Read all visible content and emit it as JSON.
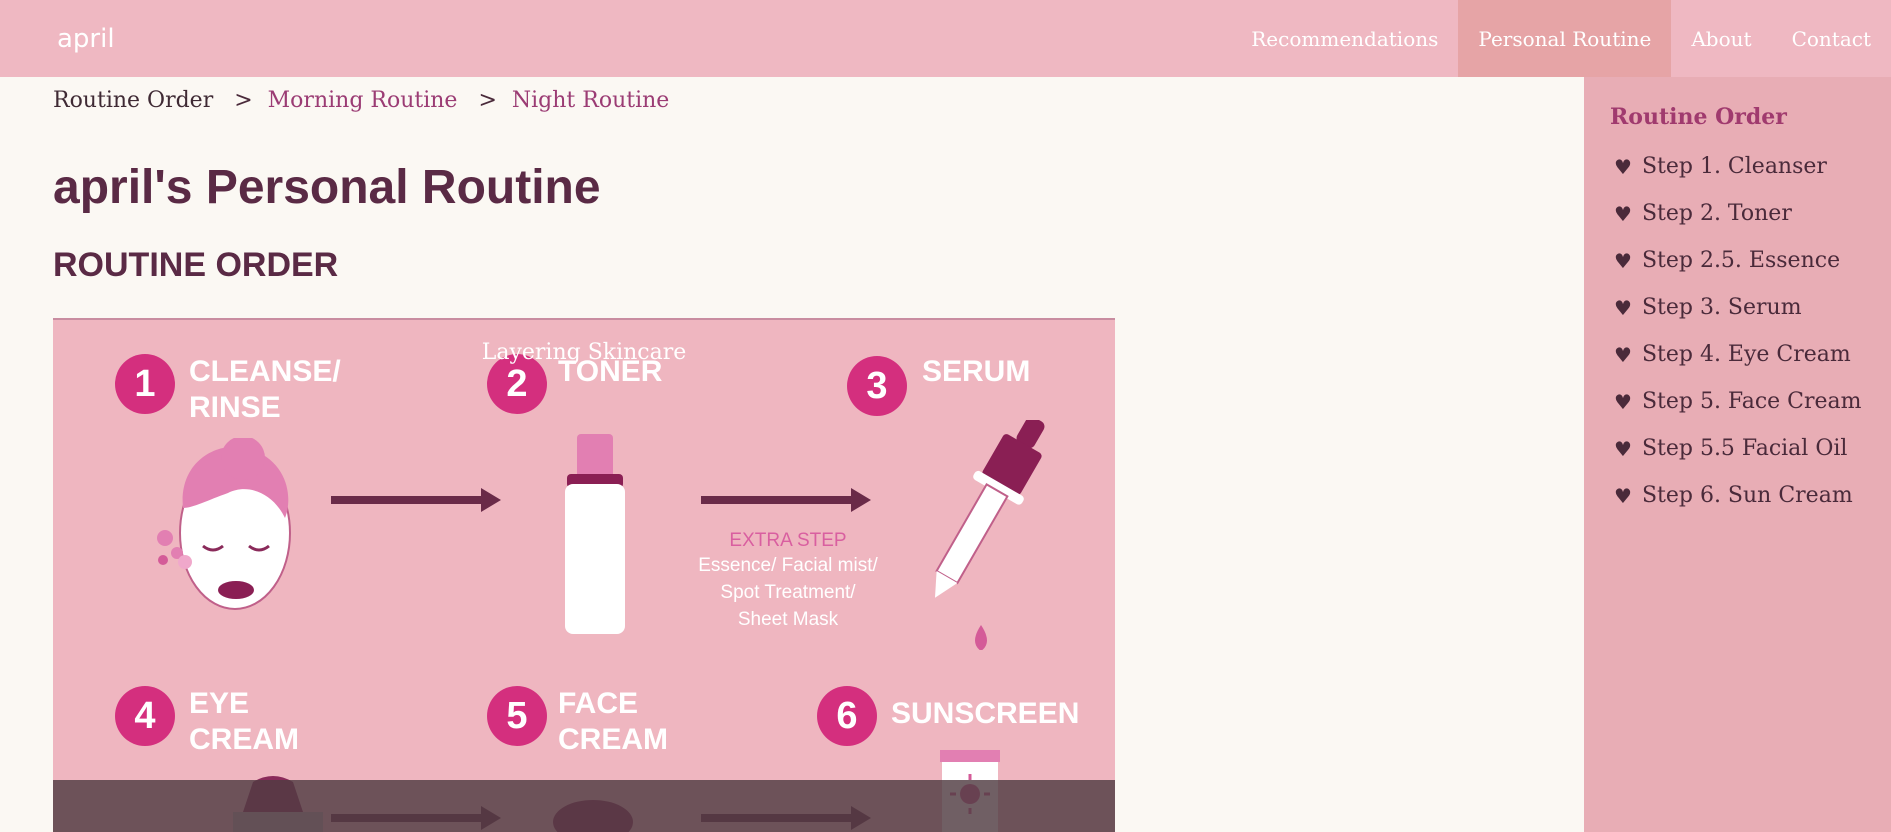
{
  "brand": "april",
  "nav": {
    "items": [
      {
        "label": "Recommendations"
      },
      {
        "label": "Personal Routine"
      },
      {
        "label": "About"
      },
      {
        "label": "Contact"
      }
    ]
  },
  "breadcrumb": {
    "current": "Routine Order",
    "sep": ">",
    "links": [
      "Morning Routine",
      "Night Routine"
    ]
  },
  "page": {
    "title": "april's Personal Routine",
    "section_title": "ROUTINE ORDER"
  },
  "infographic": {
    "steps": [
      {
        "num": "1",
        "label": "CLEANSE/\nRINSE"
      },
      {
        "num": "2",
        "label": "TONER"
      },
      {
        "num": "3",
        "label": "SERUM"
      },
      {
        "num": "4",
        "label": "EYE\nCREAM"
      },
      {
        "num": "5",
        "label": "FACE\nCREAM"
      },
      {
        "num": "6",
        "label": "SUNSCREEN"
      }
    ],
    "extra_title": "EXTRA STEP",
    "extra_lines": [
      "Essence/ Facial mist/",
      "Spot Treatment/",
      "Sheet Mask"
    ],
    "caption": "Layering Skincare"
  },
  "sidebar": {
    "title": "Routine Order",
    "items": [
      {
        "label": "Step 1. Cleanser"
      },
      {
        "label": "Step 2. Toner"
      },
      {
        "label": "Step 2.5. Essence"
      },
      {
        "label": "Step 3. Serum"
      },
      {
        "label": "Step 4. Eye Cream"
      },
      {
        "label": "Step 5. Face Cream"
      },
      {
        "label": "Step 5.5 Facial Oil"
      },
      {
        "label": "Step 6. Sun Cream"
      }
    ],
    "bullet": "♥"
  },
  "colors": {
    "topbar": "#efb8c2",
    "active_nav": "#e6a4a6",
    "sidebar": "#e8adb5",
    "accent": "#a03a6e",
    "badge": "#d42f7e",
    "title": "#5a2a45"
  },
  "icons": [
    "heart-icon",
    "face-icon",
    "toner-bottle-icon",
    "dropper-icon",
    "eye-cream-jar-icon",
    "face-cream-icon",
    "sunscreen-tube-icon",
    "arrow-right-icon"
  ]
}
